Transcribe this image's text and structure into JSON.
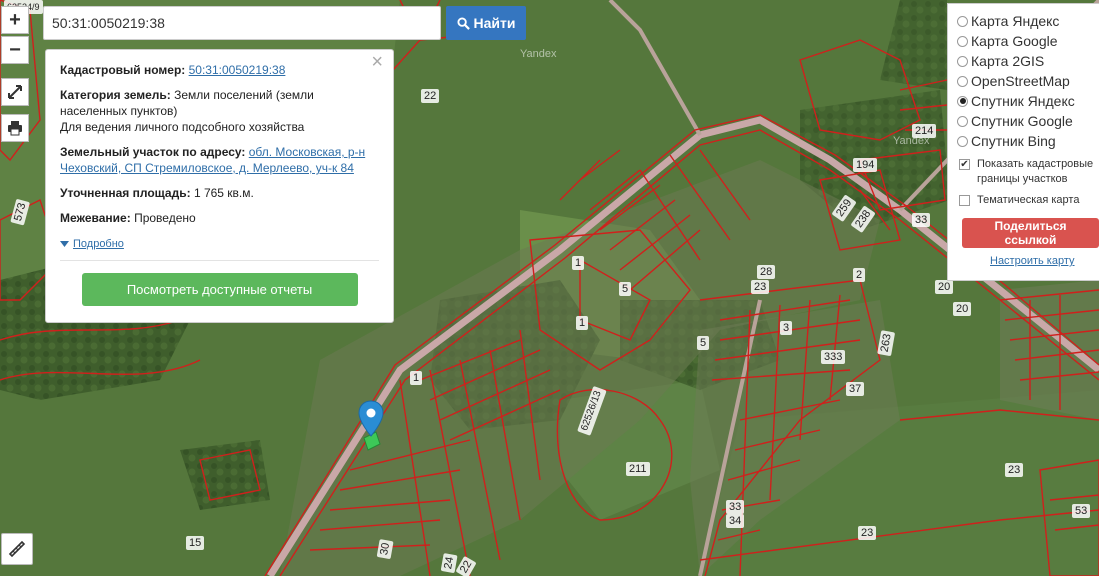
{
  "search": {
    "value": "50:31:0050219:38",
    "button_label": "Найти"
  },
  "controls": {
    "zoom_in": "+",
    "zoom_out": "−"
  },
  "info": {
    "cadastral_label": "Кадастровый номер:",
    "cadastral_value": "50:31:0050219:38",
    "category_label": "Категория земель:",
    "category_value": "Земли поселений (земли населенных пунктов)",
    "category_use": "Для ведения личного подсобного хозяйства",
    "address_label": "Земельный участок по адресу:",
    "address_value": "обл. Московская, р-н Чеховский, СП Стремиловское, д. Мерлеево, уч-к 84",
    "area_label": "Уточненная площадь:",
    "area_value": "1 765 кв.м.",
    "survey_label": "Межевание:",
    "survey_value": "Проведено",
    "details_link": "Подробно",
    "reports_button": "Посмотреть доступные отчеты",
    "close": "×"
  },
  "layers": {
    "options": [
      {
        "label": "Карта Яндекс",
        "selected": false
      },
      {
        "label": "Карта Google",
        "selected": false
      },
      {
        "label": "Карта 2GIS",
        "selected": false
      },
      {
        "label": "OpenStreetMap",
        "selected": false
      },
      {
        "label": "Спутник Яндекс",
        "selected": true
      },
      {
        "label": "Спутник Google",
        "selected": false
      },
      {
        "label": "Спутник Bing",
        "selected": false
      }
    ],
    "show_cadastral": {
      "label": "Показать кадастровые границы участков",
      "checked": true
    },
    "thematic": {
      "label": "Тематическая карта",
      "checked": false
    },
    "share_button": "Поделиться ссылкой",
    "configure_link": "Настроить карту"
  },
  "map": {
    "watermarks": [
      "Yandex",
      "Yandex"
    ],
    "labels": [
      "22",
      "62524/9",
      "573",
      "214",
      "194",
      "33",
      "259",
      "238",
      "2",
      "28",
      "23",
      "1",
      "5",
      "1",
      "20",
      "20",
      "333",
      "263",
      "37",
      "5",
      "3",
      "1",
      "62526/13",
      "211",
      "23",
      "33",
      "34",
      "53",
      "23",
      "15",
      "30",
      "24",
      "22"
    ],
    "colors": {
      "boundary": "#d0201c",
      "road": "#c9a8a8",
      "field": "#5b7d3e"
    }
  }
}
